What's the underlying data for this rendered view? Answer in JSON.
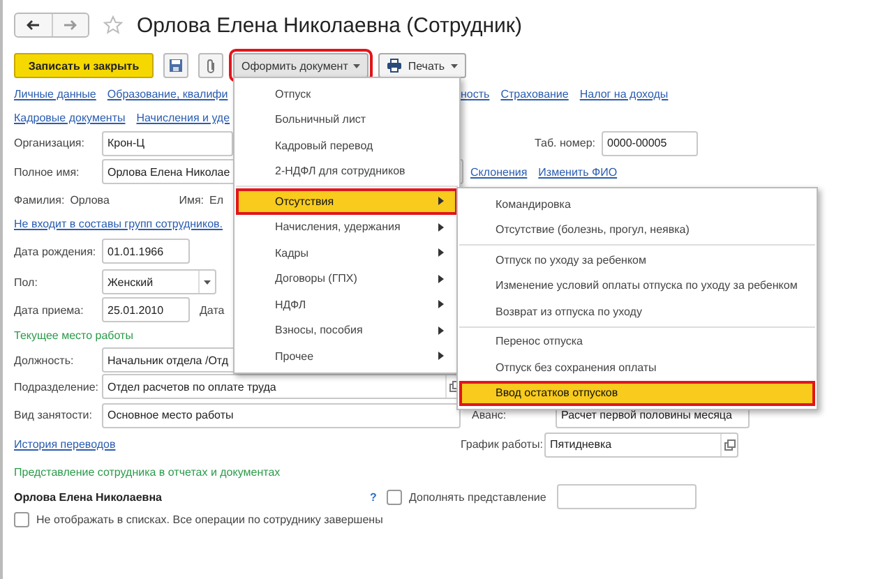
{
  "title": "Орлова Елена Николаевна (Сотрудник)",
  "toolbar": {
    "save_close": "Записать и закрыть",
    "create_document": {
      "label": "Оформить документ",
      "expanded": true
    },
    "print": "Печать"
  },
  "link_rows": [
    {
      "left": [
        "Личные данные",
        "Образование, квалифи"
      ],
      "right": [
        "ность",
        "Страхование",
        "Налог на доходы"
      ]
    },
    {
      "left": [
        "Кадровые документы",
        "Начисления и уде"
      ],
      "right": []
    }
  ],
  "organization": {
    "label": "Организация:",
    "value": "Крон-Ц"
  },
  "tab_number": {
    "label": "Таб. номер:",
    "value": "0000-00005"
  },
  "full_name": {
    "label": "Полное имя:",
    "value": "Орлова Елена Николае",
    "links": [
      "Склонения",
      "Изменить ФИО"
    ]
  },
  "surname": {
    "label": "Фамилия:",
    "value": "Орлова"
  },
  "first_name": {
    "label": "Имя:",
    "value": "Ел"
  },
  "groups_link": "Не входит в составы групп сотрудников.",
  "birth_date": {
    "label": "Дата рождения:",
    "value": "01.01.1966"
  },
  "gender": {
    "label": "Пол:",
    "value": "Женский"
  },
  "hire_date": {
    "label": "Дата приема:",
    "value": "25.01.2010",
    "next_label": "Дата"
  },
  "workplace_heading": "Текущее место работы",
  "position": {
    "label": "Должность:",
    "value": "Начальник отдела /Отд"
  },
  "department": {
    "label": "Подразделение:",
    "value": "Отдел расчетов по оплате труда"
  },
  "employment": {
    "label": "Вид занятости:",
    "value": "Основное место работы"
  },
  "advance": {
    "label": "Аванс:",
    "value": "Расчет первой половины месяца"
  },
  "history_link": "История переводов",
  "schedule": {
    "label": "График работы:",
    "value": "Пятидневка"
  },
  "presentation_heading": "Представление сотрудника в отчетах и документах",
  "presentation": {
    "name": "Орлова Елена Николаевна",
    "help": "?",
    "supplement": {
      "label": "Дополнять представление",
      "checked": false
    }
  },
  "hide": {
    "label": "Не отображать в списках. Все операции по сотруднику завершены",
    "checked": false
  },
  "menu": {
    "items": [
      {
        "kind": "command",
        "label": "Отпуск",
        "selected": false
      },
      {
        "kind": "command",
        "label": "Больничный лист",
        "selected": false
      },
      {
        "kind": "command",
        "label": "Кадровый перевод",
        "selected": false
      },
      {
        "kind": "command",
        "label": "2-НДФЛ для сотрудников",
        "selected": false
      },
      {
        "kind": "separator"
      },
      {
        "kind": "submenu",
        "label": "Отсутствия",
        "selected": true
      },
      {
        "kind": "submenu",
        "label": "Начисления, удержания",
        "selected": false
      },
      {
        "kind": "submenu",
        "label": "Кадры",
        "selected": false
      },
      {
        "kind": "submenu",
        "label": "Договоры (ГПХ)",
        "selected": false
      },
      {
        "kind": "submenu",
        "label": "НДФЛ",
        "selected": false
      },
      {
        "kind": "submenu",
        "label": "Взносы, пособия",
        "selected": false
      },
      {
        "kind": "submenu",
        "label": "Прочее",
        "selected": false
      }
    ]
  },
  "submenu": {
    "items": [
      {
        "kind": "command",
        "label": "Командировка",
        "selected": false
      },
      {
        "kind": "command",
        "label": "Отсутствие (болезнь, прогул, неявка)",
        "selected": false
      },
      {
        "kind": "separator"
      },
      {
        "kind": "command",
        "label": "Отпуск по уходу за ребенком",
        "selected": false
      },
      {
        "kind": "command",
        "label": "Изменение условий оплаты отпуска по уходу за ребенком",
        "selected": false
      },
      {
        "kind": "command",
        "label": "Возврат из отпуска по уходу",
        "selected": false
      },
      {
        "kind": "separator"
      },
      {
        "kind": "command",
        "label": "Перенос отпуска",
        "selected": false
      },
      {
        "kind": "command",
        "label": "Отпуск без сохранения оплаты",
        "selected": false
      },
      {
        "kind": "command",
        "label": "Ввод остатков отпусков",
        "selected": true
      }
    ]
  }
}
